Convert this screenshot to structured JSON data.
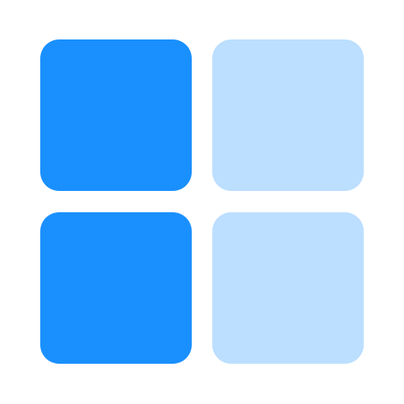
{
  "icon": {
    "name": "grid-four-squares-icon",
    "colors": {
      "primary": "#1a90ff",
      "secondary": "#bcdfff",
      "background": "#ffffff"
    },
    "tiles": [
      {
        "name": "tile-top-left",
        "color": "#1a90ff"
      },
      {
        "name": "tile-top-right",
        "color": "#bcdfff"
      },
      {
        "name": "tile-bottom-left",
        "color": "#1a90ff"
      },
      {
        "name": "tile-bottom-right",
        "color": "#bcdfff"
      }
    ]
  }
}
